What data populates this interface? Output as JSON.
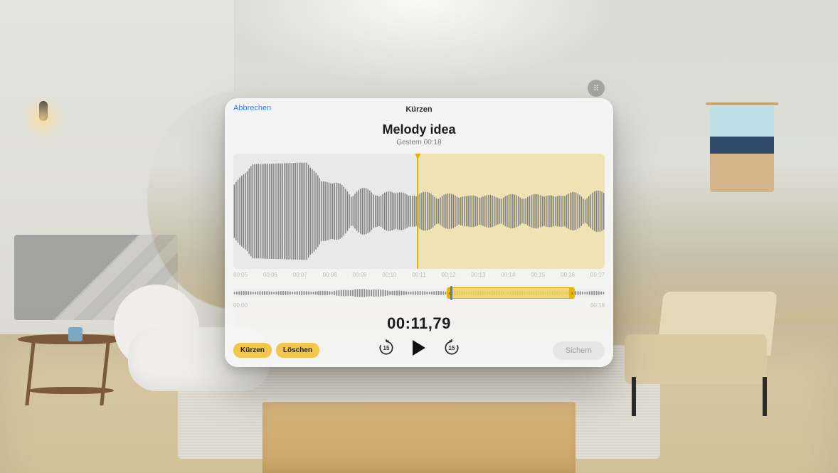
{
  "header": {
    "cancel": "Abbrechen",
    "title": "Kürzen"
  },
  "memo": {
    "title": "Melody idea",
    "date": "Gestern",
    "duration": "00:18"
  },
  "ruler": [
    "00:05",
    "00:06",
    "00:07",
    "00:08",
    "00:09",
    "00:10",
    "00:11",
    "00:12",
    "00:13",
    "00:14",
    "00:15",
    "00:16",
    "00:17"
  ],
  "scrub": {
    "start_label": "00:00",
    "end_label": "00:18",
    "playhead_pct": 58.5,
    "sel_start_pct": 57.5,
    "sel_end_pct": 92
  },
  "time_display": "00:11,79",
  "buttons": {
    "trim": "Kürzen",
    "delete": "Löschen",
    "save": "Sichern",
    "skip_amount": "15"
  },
  "colors": {
    "accent": "#f1c84b",
    "link": "#3b7bff"
  }
}
